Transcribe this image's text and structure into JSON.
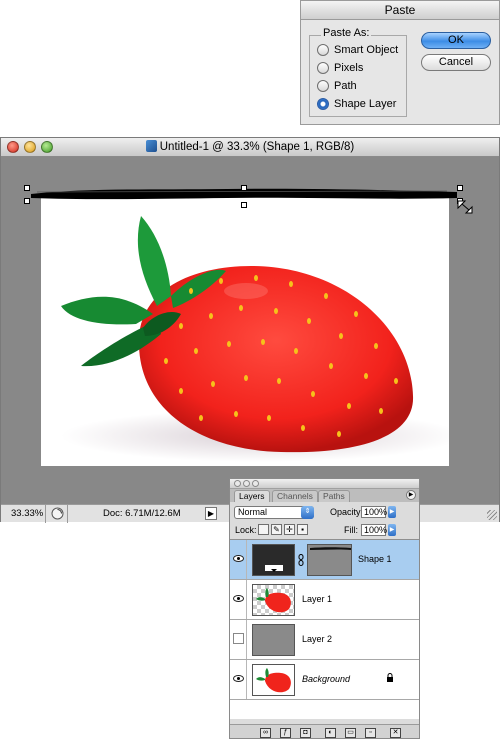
{
  "paste_dialog": {
    "title": "Paste",
    "group_label": "Paste As:",
    "options": [
      "Smart Object",
      "Pixels",
      "Path",
      "Shape Layer"
    ],
    "selected_option": "Shape Layer",
    "ok_label": "OK",
    "cancel_label": "Cancel"
  },
  "document": {
    "title": "Untitled-1 @ 33.3% (Shape 1, RGB/8)",
    "zoom": "33.33%",
    "doc_size": "Doc: 6.71M/12.6M"
  },
  "layers_palette": {
    "tabs": [
      "Layers",
      "Channels",
      "Paths"
    ],
    "active_tab": "Layers",
    "blend_mode": "Normal",
    "opacity_label": "Opacity:",
    "opacity_value": "100%",
    "lock_label": "Lock:",
    "fill_label": "Fill:",
    "fill_value": "100%",
    "layers": [
      {
        "name": "Shape 1",
        "visible": true,
        "selected": true
      },
      {
        "name": "Layer 1",
        "visible": true,
        "selected": false
      },
      {
        "name": "Layer 2",
        "visible": false,
        "selected": false
      },
      {
        "name": "Background",
        "visible": true,
        "selected": false,
        "locked": true
      }
    ]
  },
  "colors": {
    "selection": "#a8cdf0",
    "strawberry": "#ff2a2a",
    "leaf": "#1d8a35",
    "pasteboard": "#888888",
    "default_button": "#3d8de6"
  }
}
